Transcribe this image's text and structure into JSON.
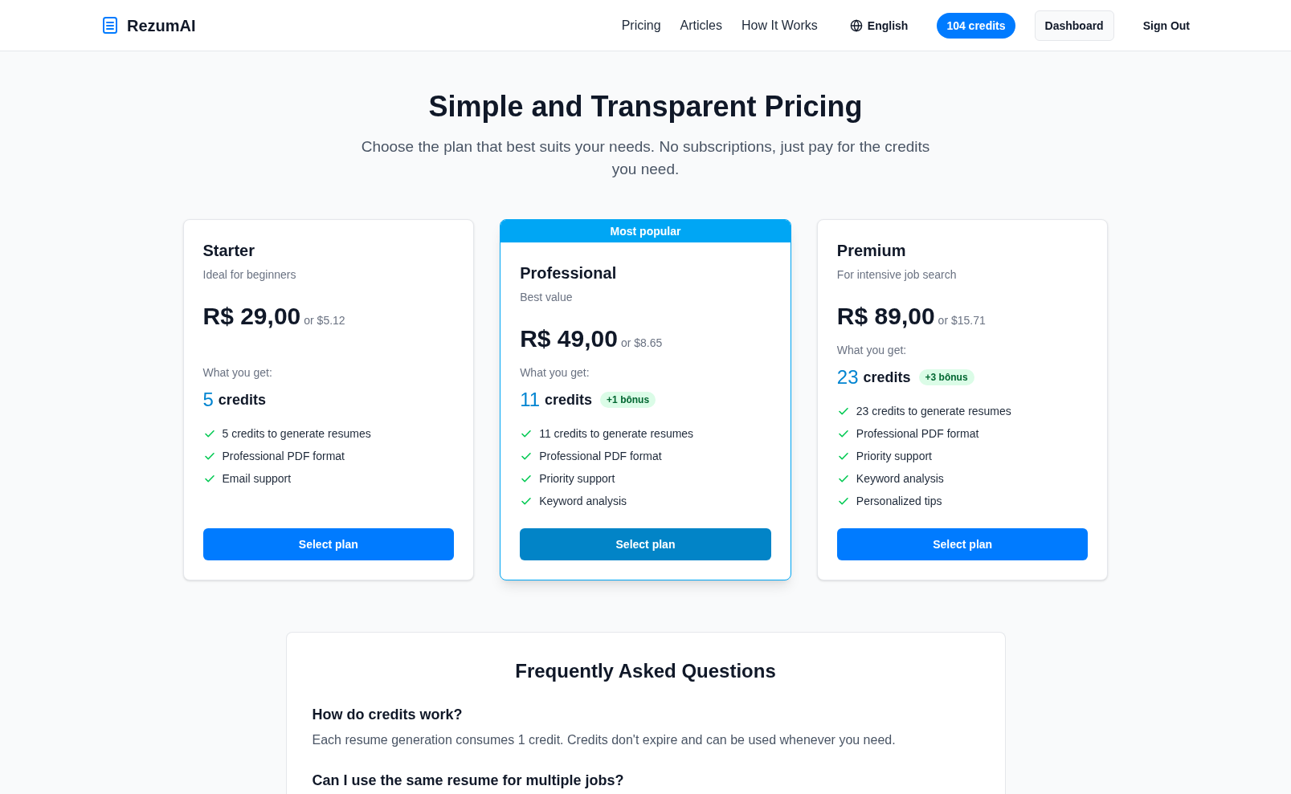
{
  "header": {
    "logo": "RezumAI",
    "nav": [
      "Pricing",
      "Articles",
      "How It Works"
    ],
    "language": "English",
    "credits": "104 credits",
    "buttons": [
      {
        "label": "Dashboard",
        "kind": "outlined"
      },
      {
        "label": "Sign Out",
        "kind": "plain"
      }
    ]
  },
  "hero": {
    "title": "Simple and Transparent Pricing",
    "subtitle": "Choose the plan that best suits your needs. No subscriptions, just pay for the credits you need."
  },
  "plans": [
    {
      "name": "Starter",
      "tagline": "Ideal for beginners",
      "price": "R$ 29,00",
      "alt_price": "or $5.12",
      "includes_label": "What you get:",
      "credits_count": "5",
      "credits_label": "credits",
      "features": [
        "5 credits to generate resumes",
        "Professional PDF format",
        "Email support"
      ],
      "button": "Select plan",
      "featured": false
    },
    {
      "badge": "Most popular",
      "name": "Professional",
      "tagline": "Best value",
      "price": "R$ 49,00",
      "alt_price": "or $8.65",
      "includes_label": "What you get:",
      "credits_count": "11",
      "credits_label": "credits",
      "bonus": "+1 bônus",
      "features": [
        "11 credits to generate resumes",
        "Professional PDF format",
        "Priority support",
        "Keyword analysis"
      ],
      "button": "Select plan",
      "featured": true
    },
    {
      "name": "Premium",
      "tagline": "For intensive job search",
      "price": "R$ 89,00",
      "alt_price": "or $15.71",
      "includes_label": "What you get:",
      "credits_count": "23",
      "credits_label": "credits",
      "bonus": "+3 bônus",
      "features": [
        "23 credits to generate resumes",
        "Professional PDF format",
        "Priority support",
        "Keyword analysis",
        "Personalized tips"
      ],
      "button": "Select plan",
      "featured": false
    }
  ],
  "faq": {
    "title": "Frequently Asked Questions",
    "items": [
      {
        "question": "How do credits work?",
        "answer": "Each resume generation consumes 1 credit. Credits don't expire and can be used whenever you need."
      },
      {
        "question": "Can I use the same resume for multiple jobs?"
      }
    ]
  }
}
